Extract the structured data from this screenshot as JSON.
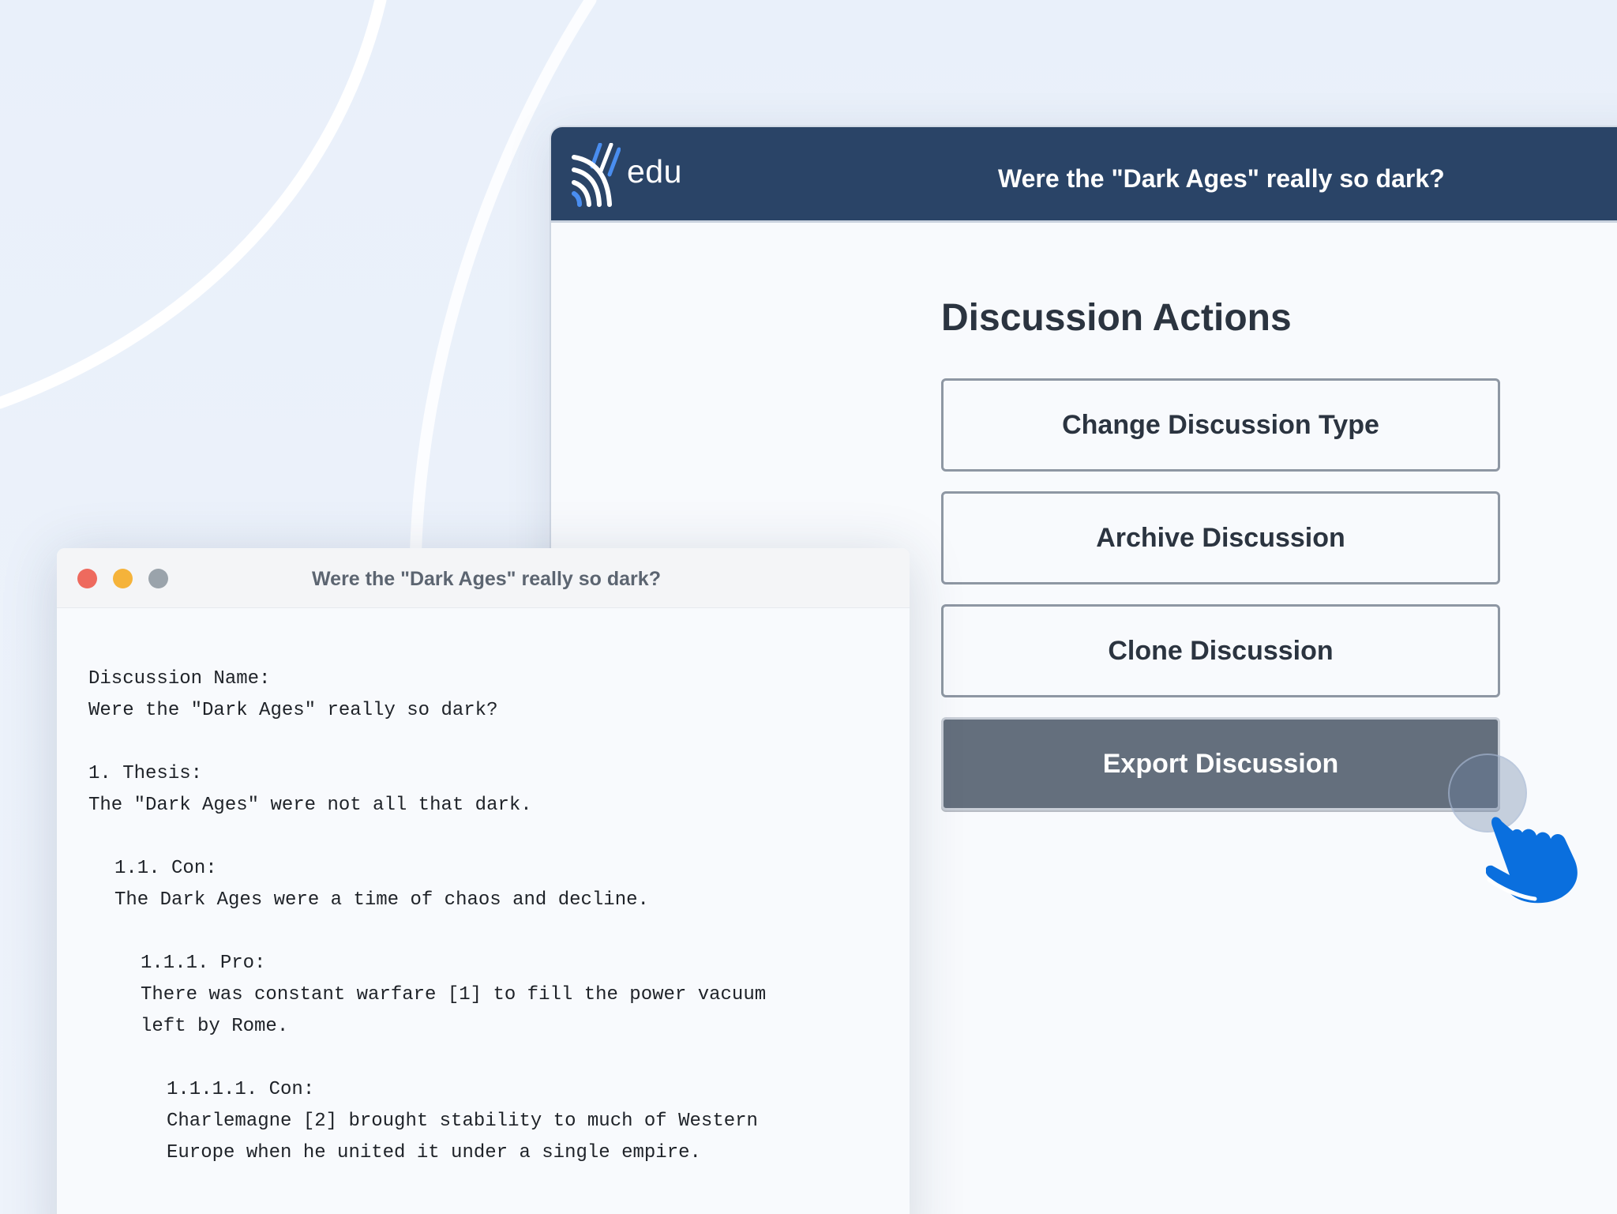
{
  "app": {
    "logo_text": "edu",
    "header_title": "Were the \"Dark Ages\" really so dark?",
    "section_title": "Discussion Actions",
    "actions": {
      "change_type": "Change Discussion Type",
      "archive": "Archive Discussion",
      "clone": "Clone Discussion",
      "export": "Export Discussion"
    }
  },
  "export_window": {
    "title": "Were the \"Dark Ages\" really so dark?",
    "content": {
      "name_label": "Discussion Name:",
      "name_value": "Were the \"Dark Ages\" really so dark?",
      "thesis_label": "1. Thesis:",
      "thesis_text": "The \"Dark Ages\" were not all that dark.",
      "con1_label": "1.1. Con:",
      "con1_text": "The Dark Ages were a time of chaos and decline.",
      "pro1_label": "1.1.1. Pro:",
      "pro1_text_1": "There was constant warfare [1] to fill the power vacuum",
      "pro1_text_2": "left by Rome.",
      "con2_label": "1.1.1.1. Con:",
      "con2_text_1": "Charlemagne [2] brought stability to much of Western",
      "con2_text_2": "Europe when he united it under a single empire."
    }
  },
  "colors": {
    "header_bg": "#2a4467",
    "export_button_bg": "#646f7d",
    "pointer_blue": "#0a6fde",
    "traffic_red": "#ee6a5e",
    "traffic_yellow": "#f5b33a",
    "traffic_gray": "#9aa3ab"
  },
  "icons": {
    "logo": "edu-logo-icon",
    "pointer": "hand-pointer-icon"
  }
}
